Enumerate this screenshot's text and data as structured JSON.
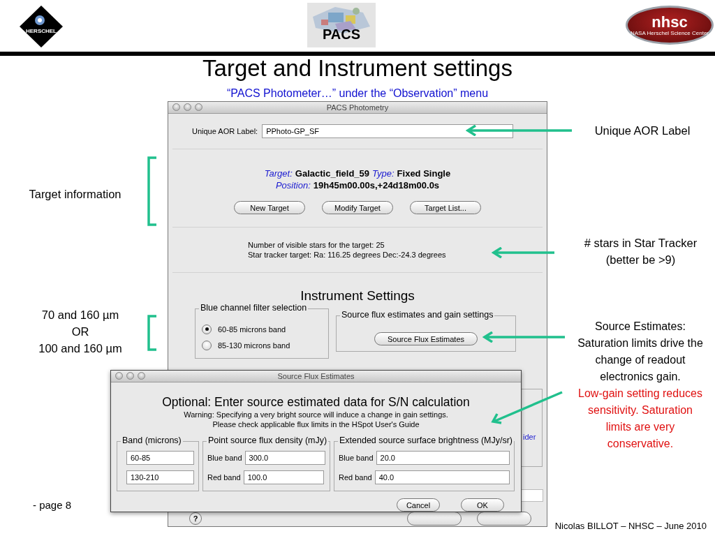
{
  "header": {
    "left_logo": {
      "text": "HERSCHEL"
    },
    "center_logo": {
      "text": "PACS"
    },
    "right_logo": {
      "title": "nhsc",
      "subtitle": "NASA Herschel Science Center"
    }
  },
  "title": "Target and Instrument settings",
  "subtitle": "“PACS Photometer…” under the “Observation” menu",
  "main_window": {
    "title": "PACS Photometry",
    "aor_label": "Unique AOR Label:",
    "aor_value": "PPhoto-GP_SF",
    "target_fields": [
      {
        "label": "Target:",
        "value": "Galactic_field_59"
      },
      {
        "label": "Type:",
        "value": "Fixed Single"
      }
    ],
    "position": {
      "label": "Position:",
      "value": "19h45m00.00s,+24d18m00.0s"
    },
    "target_buttons": [
      "New Target",
      "Modify Target",
      "Target List..."
    ],
    "star_info": [
      "Number of visible stars for the target: 25",
      "Star tracker target: Ra: 116.25 degrees Dec:-24.3 degrees"
    ],
    "section_title": "Instrument Settings",
    "filter_group": {
      "title": "Blue channel filter selection",
      "options": [
        {
          "label": "60-85 microns band",
          "selected": true
        },
        {
          "label": "85-130 microns band",
          "selected": false
        }
      ]
    },
    "flux_group": {
      "title": "Source flux estimates and gain settings",
      "button": "Source Flux Estimates"
    },
    "link_fragment": "ider",
    "help_button": "?"
  },
  "dialog": {
    "title": "Source Flux Estimates",
    "heading": "Optional: Enter source estimated data for S/N calculation",
    "warning": [
      "Warning: Specifying a very bright source will induce a change in gain settings.",
      "Please check applicable flux limits in the HSpot User's Guide"
    ],
    "band_group": {
      "title": "Band (microns)",
      "values": [
        "60-85",
        "130-210"
      ]
    },
    "point_group": {
      "title": "Point source flux density (mJy)",
      "rows": [
        {
          "label": "Blue band",
          "value": "300.0"
        },
        {
          "label": "Red band",
          "value": "100.0"
        }
      ]
    },
    "extended_group": {
      "title": "Extended source surface brightness (MJy/sr)",
      "rows": [
        {
          "label": "Blue band",
          "value": "20.0"
        },
        {
          "label": "Red band",
          "value": "40.0"
        }
      ]
    },
    "buttons": [
      "Cancel",
      "OK"
    ]
  },
  "callouts_right": {
    "aor": "Unique AOR Label",
    "stars": [
      "# stars in Star Tracker",
      "(better be >9)"
    ],
    "source": {
      "heading": "Source Estimates:",
      "text": "Saturation limits drive the change of readout electronics gain.",
      "warning": "Low-gain setting reduces sensitivity. Saturation limits are very conservative."
    }
  },
  "callouts_left": {
    "target": "Target information",
    "filters": [
      "70 and 160 µm",
      "OR",
      "100 and 160 µm"
    ]
  },
  "page_label": "- page 8",
  "footer": "Nicolas BILLOT – NHSC – June 2010"
}
